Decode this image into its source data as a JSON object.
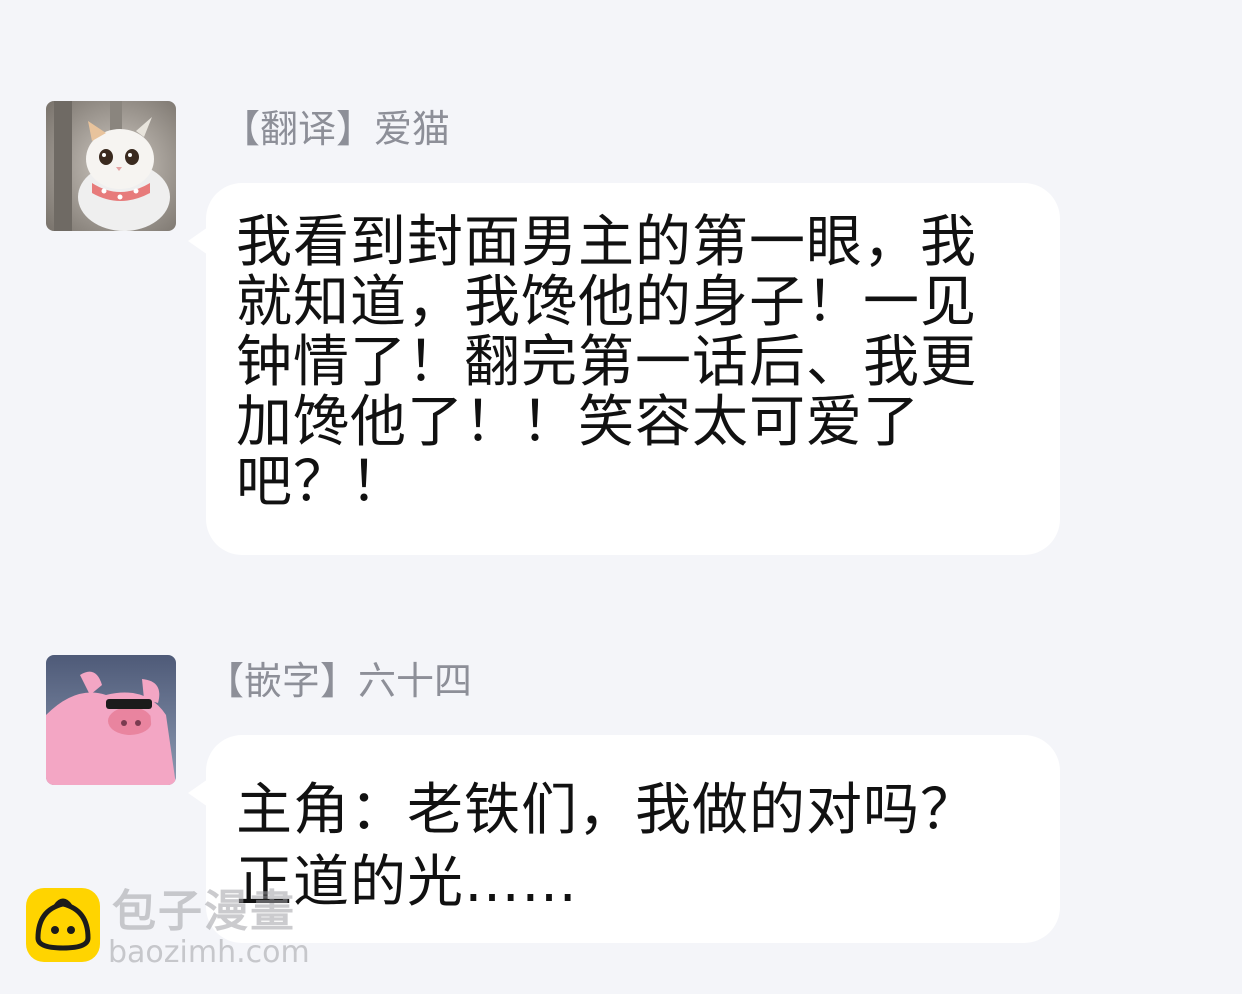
{
  "messages": [
    {
      "sender": "【翻译】爱猫",
      "avatar": "cat-avatar",
      "text": "我看到封面男主的第一眼，我\n就知道，我馋他的身子！一见\n钟情了！翻完第一话后、我更\n加馋他了！！笑容太可爱了\n吧？！"
    },
    {
      "sender": "【嵌字】六十四",
      "avatar": "pink-pig-avatar",
      "text": "主角：老铁们，我做的对吗？\n正道的光……"
    }
  ],
  "watermark": {
    "title": "包子漫畫",
    "url": "baozimh.com",
    "logo": "bun-logo-icon"
  },
  "colors": {
    "background": "#f4f5f9",
    "bubble": "#ffffff",
    "sender_text": "#8d8f98",
    "message_text": "#111111",
    "logo_yellow": "#ffd400"
  }
}
